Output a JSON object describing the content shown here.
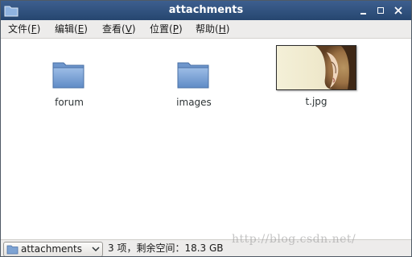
{
  "window": {
    "title": "attachments"
  },
  "menu": [
    {
      "text": "文件(",
      "key": "F",
      "end": ")"
    },
    {
      "text": "编辑(",
      "key": "E",
      "end": ")"
    },
    {
      "text": "查看(",
      "key": "V",
      "end": ")"
    },
    {
      "text": "位置(",
      "key": "P",
      "end": ")"
    },
    {
      "text": "帮助(",
      "key": "H",
      "end": ")"
    }
  ],
  "files": [
    {
      "name": "forum",
      "icon": "folder-icon"
    },
    {
      "name": "images",
      "icon": "folder-icon"
    },
    {
      "name": "t.jpg",
      "icon": "image-thumbnail"
    }
  ],
  "statusbar": {
    "location": "attachments",
    "summary": "3 项，剩余空间：18.3 GB"
  },
  "watermark": "http://blog.csdn.net/",
  "colors": {
    "titlebar": "#2f527f",
    "folder": "#7ea3d3",
    "menubar": "#edeceb"
  }
}
